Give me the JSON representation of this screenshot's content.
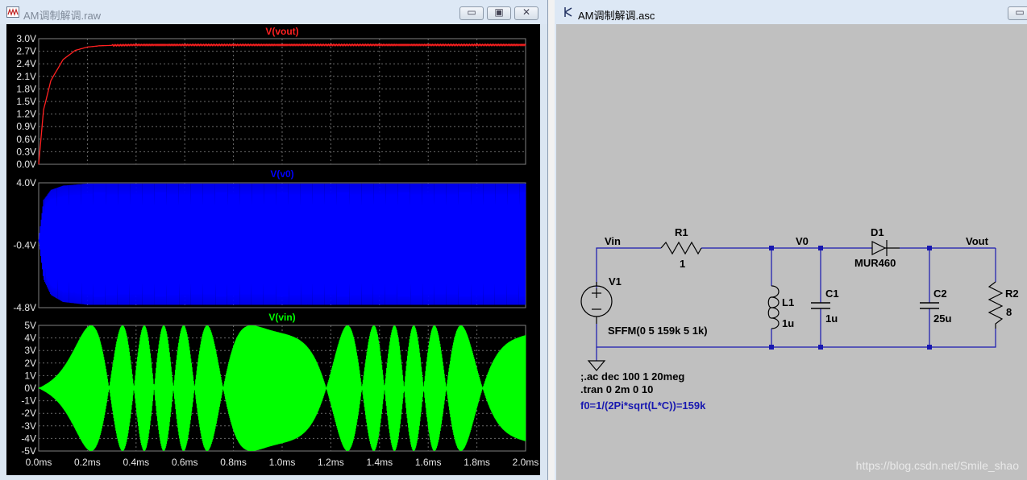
{
  "left_window": {
    "title": "AM调制解调.raw",
    "controls": {
      "minimize": "▭",
      "restore": "▣",
      "close": "✕"
    }
  },
  "right_window": {
    "title": "AM调制解调.asc"
  },
  "colors": {
    "vout": "#ff2020",
    "v0": "#0000ff",
    "vin": "#00ff00"
  },
  "chart_data": [
    {
      "type": "line",
      "title": "V(vout)",
      "y_ticks": [
        "3.0V",
        "2.7V",
        "2.4V",
        "2.1V",
        "1.8V",
        "1.5V",
        "1.2V",
        "0.9V",
        "0.6V",
        "0.3V",
        "0.0V"
      ],
      "ylim": [
        0,
        3.0
      ],
      "x_ticks": [
        "0.0ms",
        "0.2ms",
        "0.4ms",
        "0.6ms",
        "0.8ms",
        "1.0ms",
        "1.2ms",
        "1.4ms",
        "1.6ms",
        "1.8ms",
        "2.0ms"
      ],
      "xlim": [
        0,
        2.0
      ],
      "series": [
        {
          "name": "V(vout)",
          "x": [
            0,
            0.02,
            0.05,
            0.1,
            0.15,
            0.2,
            0.25,
            0.3,
            0.4,
            0.6,
            1.0,
            1.5,
            2.0
          ],
          "values": [
            0,
            1.3,
            2.0,
            2.5,
            2.72,
            2.8,
            2.83,
            2.84,
            2.85,
            2.85,
            2.85,
            2.85,
            2.85
          ]
        }
      ]
    },
    {
      "type": "line",
      "title": "V(v0)",
      "y_ticks": [
        "4.0V",
        "-0.4V",
        "-4.8V"
      ],
      "ylim": [
        -4.8,
        4.0
      ],
      "x_ticks": [
        "0.0ms",
        "0.2ms",
        "0.4ms",
        "0.6ms",
        "0.8ms",
        "1.0ms",
        "1.2ms",
        "1.4ms",
        "1.6ms",
        "1.8ms",
        "2.0ms"
      ],
      "xlim": [
        0,
        2.0
      ],
      "series": [
        {
          "name": "V(v0)",
          "x": [
            0,
            0.02,
            0.05,
            0.1,
            0.2,
            2.0
          ],
          "upper": [
            0,
            2.8,
            3.5,
            3.8,
            3.95,
            3.95
          ],
          "lower": [
            0,
            -2.8,
            -3.9,
            -4.4,
            -4.6,
            -4.6
          ]
        }
      ]
    },
    {
      "type": "line",
      "title": "V(vin)",
      "y_ticks": [
        "5V",
        "4V",
        "3V",
        "2V",
        "1V",
        "0V",
        "-1V",
        "-2V",
        "-3V",
        "-4V",
        "-5V"
      ],
      "ylim": [
        -5,
        5
      ],
      "x_ticks": [
        "0.0ms",
        "0.2ms",
        "0.4ms",
        "0.6ms",
        "0.8ms",
        "1.0ms",
        "1.2ms",
        "1.4ms",
        "1.6ms",
        "1.8ms",
        "2.0ms"
      ],
      "xlim": [
        0,
        2.0
      ],
      "series": [
        {
          "name": "V(vin)",
          "amplitude": 5
        }
      ]
    }
  ],
  "schematic": {
    "nets": {
      "vin": "Vin",
      "v0": "V0",
      "vout": "Vout"
    },
    "r1": {
      "name": "R1",
      "value": "1"
    },
    "d1": {
      "name": "D1",
      "value": "MUR460"
    },
    "v1": {
      "name": "V1",
      "value": "SFFM(0 5 159k 5 1k)"
    },
    "l1": {
      "name": "L1",
      "value": "1u"
    },
    "c1": {
      "name": "C1",
      "value": "1u"
    },
    "c2": {
      "name": "C2",
      "value": "25u"
    },
    "r2": {
      "name": "R2",
      "value": "8"
    },
    "directives": [
      ";.ac dec 100 1 20meg",
      ".tran 0 2m 0 10"
    ],
    "comment": "f0=1/(2Pi*sqrt(L*C))=159k"
  },
  "watermark": "https://blog.csdn.net/Smile_shao"
}
